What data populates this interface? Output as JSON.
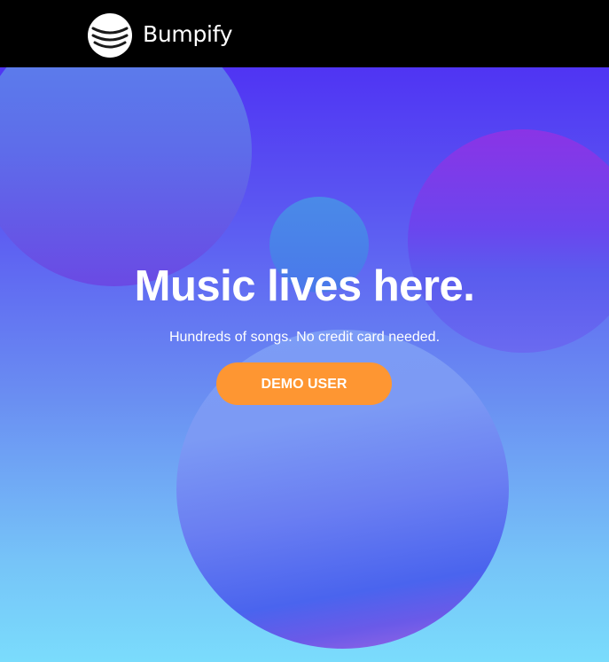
{
  "header": {
    "brand_name": "Bumpify",
    "logo_icon": "stacked-waves-icon",
    "background_color": "#000000"
  },
  "hero": {
    "headline": "Music lives here.",
    "subheadline": "Hundreds of songs. No credit card needed.",
    "cta_label": "DEMO USER"
  },
  "colors": {
    "cta_button": "#fe9632",
    "background_top": "#4a24f4",
    "background_bottom": "#7adcfc",
    "text": "#ffffff"
  }
}
